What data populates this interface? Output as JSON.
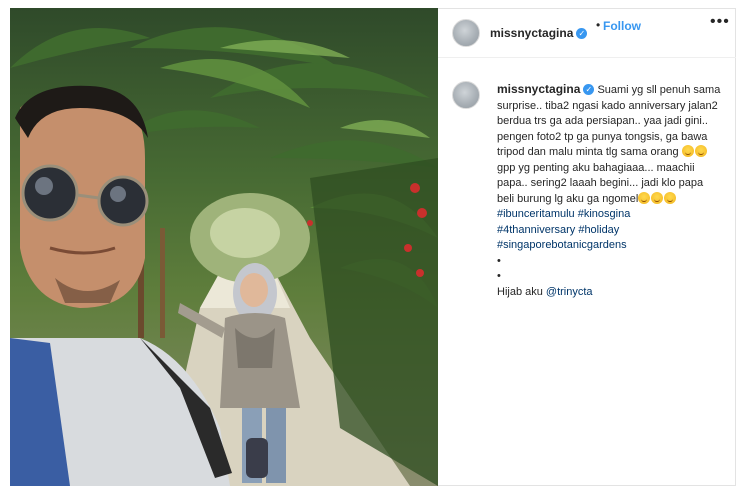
{
  "header": {
    "username": "missnyctagina",
    "separator": "•",
    "follow_label": "Follow",
    "more_label": "•••"
  },
  "caption": {
    "username": "missnyctagina",
    "text_1": "Suami yg sll penuh sama surprise.. tiba2 ngasi kado anniversary jalan2 berdua trs ga ada persiapan.. yaa jadi gini.. pengen foto2 tp ga punya tongsis, ga bawa tripod dan malu minta tlg sama orang",
    "text_2": "gpp yg penting aku bahagiaaa... maachii papa.. sering2 laaah begini... jadi klo papa beli burung lg aku ga ngomel",
    "hashtags": [
      "#ibunceritamulu #kinosgina",
      "#4thanniversary #holiday",
      "#singaporebotanicgardens"
    ],
    "dots_1": "•",
    "dots_2": "•",
    "credit_prefix": "Hijab aku ",
    "credit_mention": "@trinycta"
  },
  "icons": [
    "verified-badge-icon",
    "more-options-icon",
    "grinning-squint-emoji",
    "smiling-emoji"
  ],
  "colors": {
    "accent": "#3897f0",
    "link": "#003569",
    "text": "#262626",
    "border": "#efefef"
  }
}
